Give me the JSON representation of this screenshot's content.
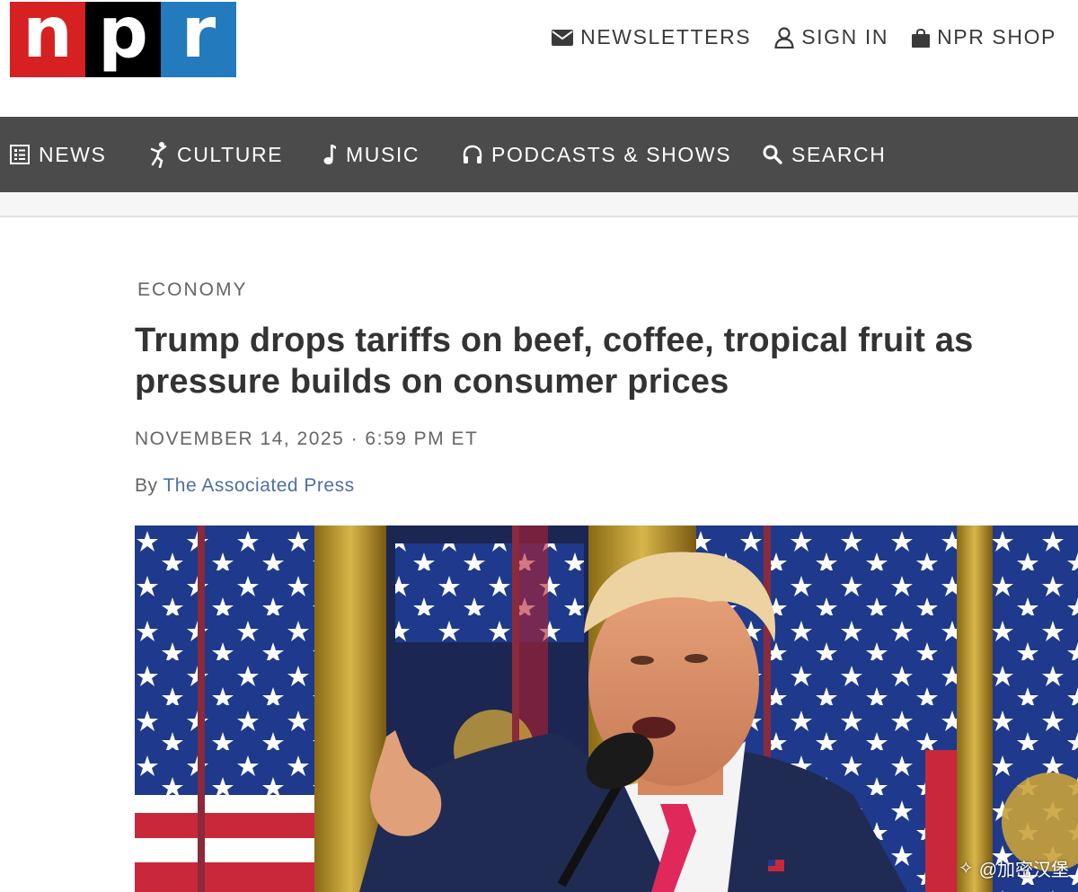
{
  "brand": {
    "logo_letters": [
      "n",
      "p",
      "r"
    ],
    "logo_colors": [
      "#d62021",
      "#000000",
      "#237bbd"
    ]
  },
  "utility_nav": {
    "newsletters": "NEWSLETTERS",
    "sign_in": "SIGN IN",
    "shop": "NPR SHOP"
  },
  "main_nav": {
    "items": [
      {
        "label": "NEWS",
        "icon": "news-list-icon"
      },
      {
        "label": "CULTURE",
        "icon": "dancer-icon"
      },
      {
        "label": "MUSIC",
        "icon": "music-note-icon"
      },
      {
        "label": "PODCASTS & SHOWS",
        "icon": "headphones-icon"
      },
      {
        "label": "SEARCH",
        "icon": "search-icon"
      }
    ]
  },
  "article": {
    "section": "ECONOMY",
    "headline": "Trump drops tariffs on beef, coffee, tropical fruit as pressure builds on consumer prices",
    "dateline": "NOVEMBER 14, 2025 · 6:59 PM ET",
    "byline_prefix": "By",
    "author": "The Associated Press"
  },
  "photo": {
    "watermark": "@加密汉堡"
  },
  "colors": {
    "nav_bg": "#4b4b4b",
    "author_link": "#4f6ea3",
    "flag_blue": "#1f3a8c",
    "flag_red": "#c8283a",
    "tie": "#e0285a"
  }
}
